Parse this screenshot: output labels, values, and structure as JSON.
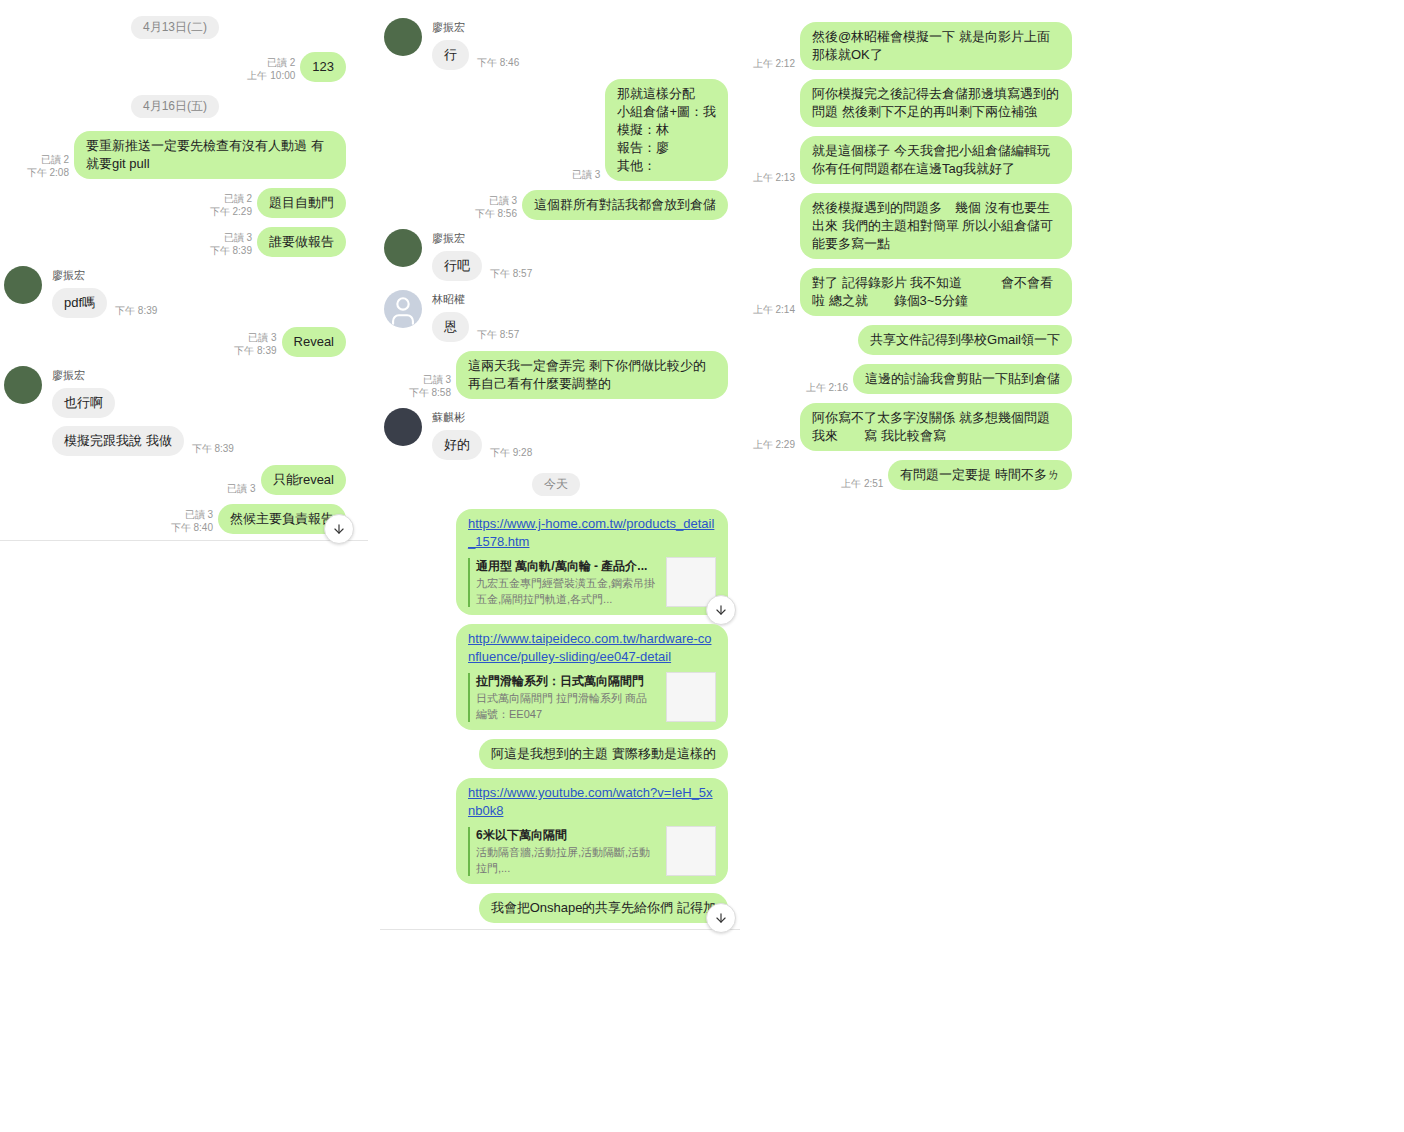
{
  "columns": [
    {
      "items": [
        {
          "kind": "date",
          "text": "4月13日(二)"
        },
        {
          "kind": "sent",
          "text": "123",
          "read": "已讀 2",
          "time": "上午 10:00",
          "scroll_button": false
        },
        {
          "kind": "date",
          "text": "4月16日(五)"
        },
        {
          "kind": "sent",
          "text": "要重新推送一定要先檢查有沒有人動過 有就要git pull",
          "read": "已讀 2",
          "time": "下午 2:08",
          "scroll_button": false
        },
        {
          "kind": "sent",
          "text": "題目自動門",
          "read": "已讀 2",
          "time": "下午 2:29",
          "scroll_button": false
        },
        {
          "kind": "sent",
          "text": "誰要做報告",
          "read": "已讀 3",
          "time": "下午 8:39",
          "scroll_button": false
        },
        {
          "kind": "received",
          "name": "廖振宏",
          "avatar": "photo",
          "color": "#4f6b4a",
          "messages": [
            {
              "text": "pdf嗎",
              "time": "下午 8:39"
            }
          ]
        },
        {
          "kind": "sent",
          "text": "Reveal",
          "read": "已讀 3",
          "time": "下午 8:39",
          "scroll_button": false
        },
        {
          "kind": "received",
          "name": "廖振宏",
          "avatar": "photo",
          "color": "#4f6b4a",
          "messages": [
            {
              "text": "也行啊",
              "time": ""
            },
            {
              "text": "模擬完跟我說 我做",
              "time": "下午 8:39"
            }
          ]
        },
        {
          "kind": "sent",
          "text": "只能reveal",
          "read": "已讀 3",
          "time": "",
          "scroll_button": false
        },
        {
          "kind": "sent",
          "text": "然候主要負責報告",
          "read": "已讀 3",
          "time": "下午 8:40",
          "scroll_button": true
        }
      ]
    },
    {
      "items": [
        {
          "kind": "received",
          "name": "廖振宏",
          "avatar": "photo",
          "color": "#4f6b4a",
          "messages": [
            {
              "text": "行",
              "time": "下午 8:46"
            }
          ]
        },
        {
          "kind": "sent",
          "text": "那就這樣分配\n小組倉儲+圖：我\n模擬：林\n報告：廖\n其他：",
          "read": "已讀 3",
          "time": "",
          "scroll_button": false
        },
        {
          "kind": "sent",
          "text": "這個群所有對話我都會放到倉儲",
          "read": "已讀 3",
          "time": "下午 8:56",
          "scroll_button": false
        },
        {
          "kind": "received",
          "name": "廖振宏",
          "avatar": "photo",
          "color": "#4f6b4a",
          "messages": [
            {
              "text": "行吧",
              "time": "下午 8:57"
            }
          ]
        },
        {
          "kind": "received",
          "name": "林昭權",
          "avatar": "default",
          "color": "#c9d1de",
          "messages": [
            {
              "text": "恩",
              "time": "下午 8:57"
            }
          ]
        },
        {
          "kind": "sent",
          "text": "這兩天我一定會弄完 剩下你們做比較少的 再自己看有什麼要調整的",
          "read": "已讀 3",
          "time": "下午 8:58",
          "scroll_button": false
        },
        {
          "kind": "received",
          "name": "蘇麒彬",
          "avatar": "photo",
          "color": "#3a3f4a",
          "messages": [
            {
              "text": "好的",
              "time": "下午 9:28"
            }
          ]
        },
        {
          "kind": "date",
          "text": "今天"
        },
        {
          "kind": "link",
          "url": "https://www.j-home.com.tw/products_detail_1578.htm",
          "title": "通用型 萬向軌/萬向輪 - 產品介...",
          "desc": "九宏五金專門經營裝潢五金,鋼索吊掛五金,隔間拉門軌道,各式門...",
          "scroll_button": true
        },
        {
          "kind": "link",
          "url": "http://www.taipeideco.com.tw/hardware-confluence/pulley-sliding/ee047-detail",
          "title": "拉門滑輪系列：日式萬向隔間門",
          "desc": "日式萬向隔間門 拉門滑輪系列 商品編號：EE047",
          "scroll_button": false
        },
        {
          "kind": "sent",
          "text": "阿這是我想到的主題 實際移動是這樣的",
          "read": "",
          "time": "",
          "scroll_button": false
        },
        {
          "kind": "link",
          "url": "https://www.youtube.com/watch?v=IeH_5xnb0k8",
          "title": "6米以下萬向隔間",
          "desc": "活動隔音牆,活動拉屏,活動隔斷,活動拉門,...",
          "scroll_button": false
        },
        {
          "kind": "sent",
          "text": "我會把Onshape的共享先給你們 記得加",
          "read": "",
          "time": "",
          "scroll_button": true
        }
      ]
    },
    {
      "items": [
        {
          "kind": "sent",
          "text": "然後@林昭權會模擬一下 就是向影片上面那樣就OK了",
          "read": "",
          "time": "上午 2:12",
          "scroll_button": false
        },
        {
          "kind": "sent",
          "text": "阿你模擬完之後記得去倉儲那邊填寫遇到的問題 然後剩下不足的再叫剩下兩位補強",
          "read": "",
          "time": "",
          "scroll_button": false
        },
        {
          "kind": "sent",
          "text": "就是這個樣子 今天我會把小組倉儲編輯玩 你有任何問題都在這邊Tag我就好了",
          "read": "",
          "time": "上午 2:13",
          "scroll_button": false
        },
        {
          "kind": "sent",
          "text": "然後模擬遇到的問題多　幾個 沒有也要生出來 我們的主題相對簡單 所以小組倉儲可能要多寫一點",
          "read": "",
          "time": "",
          "scroll_button": false
        },
        {
          "kind": "sent",
          "text": "對了 記得錄影片 我不知道　　　會不會看啦 總之就　　錄個3~5分鐘",
          "read": "",
          "time": "上午 2:14",
          "scroll_button": false
        },
        {
          "kind": "sent",
          "text": "共享文件記得到學校Gmail領一下",
          "read": "",
          "time": "",
          "scroll_button": false
        },
        {
          "kind": "sent",
          "text": "這邊的討論我會剪貼一下貼到倉儲",
          "read": "",
          "time": "上午 2:16",
          "scroll_button": false
        },
        {
          "kind": "sent",
          "text": "阿你寫不了太多字沒關係 就多想幾個問題 我來　　寫 我比較會寫",
          "read": "",
          "time": "上午 2:29",
          "scroll_button": false
        },
        {
          "kind": "sent",
          "text": "有問題一定要提 時間不多ㄌ",
          "read": "",
          "time": "上午 2:51",
          "scroll_button": false
        }
      ]
    }
  ]
}
